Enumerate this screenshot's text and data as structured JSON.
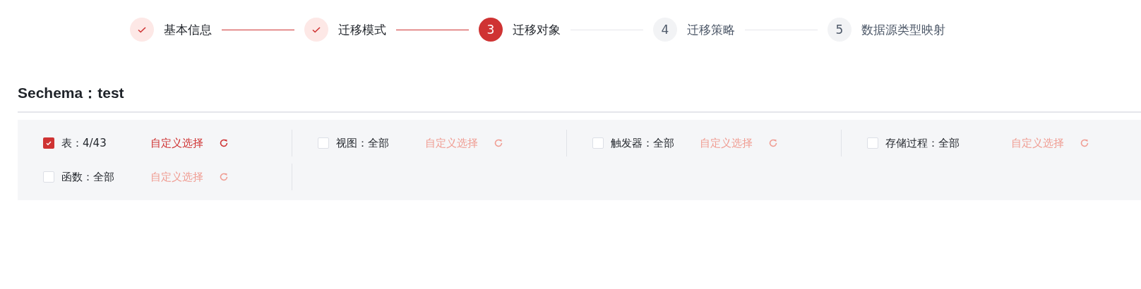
{
  "steps": [
    {
      "label": "基本信息",
      "completed": true,
      "selected": false
    },
    {
      "label": "迁移模式",
      "completed": true,
      "selected": false
    },
    {
      "marker": "3",
      "label": "迁移对象",
      "completed": false,
      "selected": true
    },
    {
      "marker": "4",
      "label": "迁移策略",
      "completed": false,
      "selected": false
    },
    {
      "marker": "5",
      "label": "数据源类型映射",
      "completed": false,
      "selected": false
    }
  ],
  "schema_title": "Sechema：test",
  "objects": [
    {
      "label": "表：4/43",
      "checked": true,
      "link": "自定义选择"
    },
    {
      "label": "视图：全部",
      "checked": false,
      "link": "自定义选择"
    },
    {
      "label": "触发器：全部",
      "checked": false,
      "link": "自定义选择"
    },
    {
      "label": "存储过程：全部",
      "checked": false,
      "link": "自定义选择"
    },
    {
      "label": "函数：全部",
      "checked": false,
      "link": "自定义选择"
    }
  ]
}
